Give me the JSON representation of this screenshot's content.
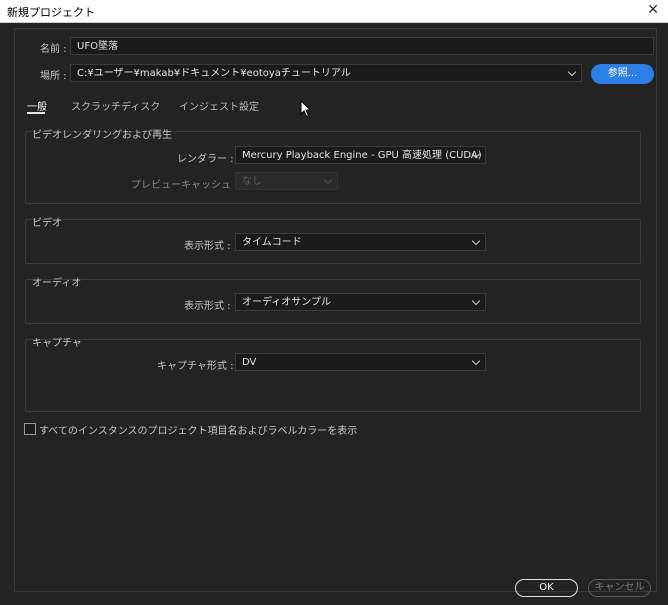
{
  "window": {
    "title": "新規プロジェクト"
  },
  "name": {
    "label": "名前 :",
    "value": "UFO墜落"
  },
  "location": {
    "label": "場所 :",
    "value": "C:¥ユーザー¥makab¥ドキュメント¥eotoyaチュートリアル",
    "browse_label": "参照..."
  },
  "tabs": [
    {
      "label": "一般",
      "active": true
    },
    {
      "label": "スクラッチディスク",
      "active": false
    },
    {
      "label": "インジェスト設定",
      "active": false
    }
  ],
  "video_rendering": {
    "title": "ビデオレンダリングおよび再生",
    "renderer_label": "レンダラー :",
    "renderer_value": "Mercury Playback Engine - GPU 高速処理 (CUDA)",
    "preview_cache_label": "プレビューキャッシュ :",
    "preview_cache_value": "なし"
  },
  "video": {
    "title": "ビデオ",
    "display_format_label": "表示形式 :",
    "display_format_value": "タイムコード"
  },
  "audio": {
    "title": "オーディオ",
    "display_format_label": "表示形式 :",
    "display_format_value": "オーディオサンプル"
  },
  "capture": {
    "title": "キャプチャ",
    "format_label": "キャプチャ形式 :",
    "format_value": "DV"
  },
  "show_labels": {
    "label": "すべてのインスタンスのプロジェクト項目名およびラベルカラーを表示",
    "checked": false
  },
  "buttons": {
    "ok": "OK",
    "cancel": "キャンセル"
  }
}
